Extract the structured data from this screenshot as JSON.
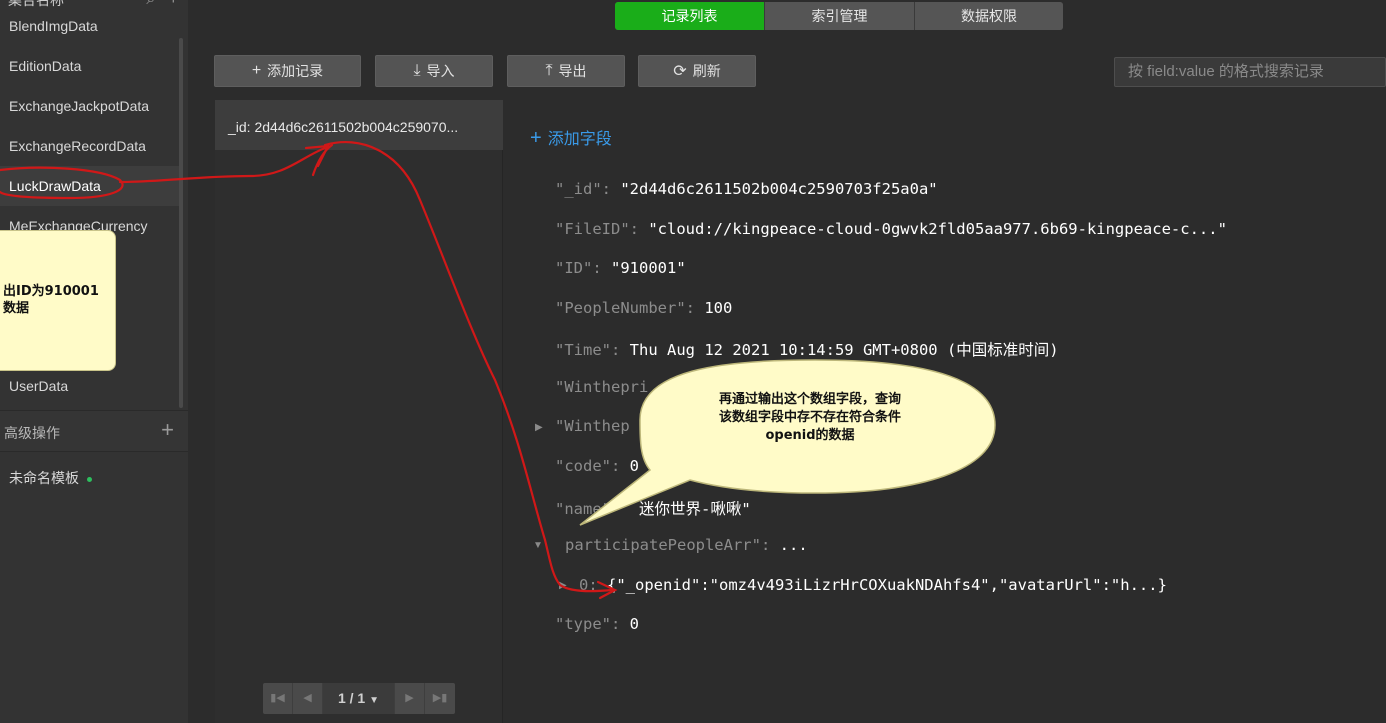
{
  "sidebar": {
    "header_label": "集合名称",
    "collections": [
      {
        "label": "BlendImgData"
      },
      {
        "label": "EditionData"
      },
      {
        "label": "ExchangeJackpotData"
      },
      {
        "label": "ExchangeRecordData"
      },
      {
        "label": "LuckDrawData"
      },
      {
        "label": "MeExchangeCurrency"
      },
      {
        "label": ""
      },
      {
        "label": ""
      },
      {
        "label": ""
      },
      {
        "label": "UserData"
      }
    ],
    "advanced_label": "高级操作",
    "template_label": "未命名模板"
  },
  "tabs": [
    {
      "label": "记录列表",
      "active": true
    },
    {
      "label": "索引管理",
      "active": false
    },
    {
      "label": "数据权限",
      "active": false
    }
  ],
  "toolbar": {
    "add_label": "添加记录",
    "import_label": "导入",
    "export_label": "导出",
    "refresh_label": "刷新",
    "search_placeholder": "按 field:value 的格式搜索记录"
  },
  "record_list": {
    "items": [
      {
        "label": "_id: 2d44d6c2611502b004c259070..."
      }
    ],
    "pager": "1 / 1"
  },
  "detail": {
    "add_field_label": "添加字段",
    "fields": [
      {
        "key": "\"_id\":",
        "value": "\"2d44d6c2611502b004c2590703f25a0a\""
      },
      {
        "key": "\"FileID\":",
        "value": "\"cloud://kingpeace-cloud-0gwvk2fld05aa977.6b69-kingpeace-c...\""
      },
      {
        "key": "\"ID\":",
        "value": "\"910001\""
      },
      {
        "key": "\"PeopleNumber\":",
        "value": "100"
      },
      {
        "key": "\"Time\":",
        "value": "Thu Aug 12 2021 10:14:59 GMT+0800 (中国标准时间)"
      },
      {
        "key": "\"Winthepri",
        "value": ""
      },
      {
        "key": "\"Winthep",
        "value": ""
      },
      {
        "key": "\"code\":",
        "value": "0"
      },
      {
        "key": "\"name\"",
        "value": "迷你世界-啾啾\""
      },
      {
        "key": "participatePeopleArr\":",
        "value": "..."
      },
      {
        "key": "0:",
        "value": "{\"_openid\":\"omz4v493iLizrHrCOXuakNDAhfs4\",\"avatarUrl\":\"h...}"
      },
      {
        "key": "\"type\":",
        "value": "0"
      }
    ]
  },
  "annotations": {
    "note_left_lines": [
      "出ID为910001",
      "数据"
    ],
    "bubble_lines": [
      "再通过输出这个数组字段，查询",
      "该数组字段中存不存在符合条件",
      "openid的数据"
    ]
  },
  "colors": {
    "accent_green": "#1aad19",
    "link_blue": "#3a9ae8",
    "annotation_red": "#d01818",
    "note_yellow": "#fffbc8"
  }
}
